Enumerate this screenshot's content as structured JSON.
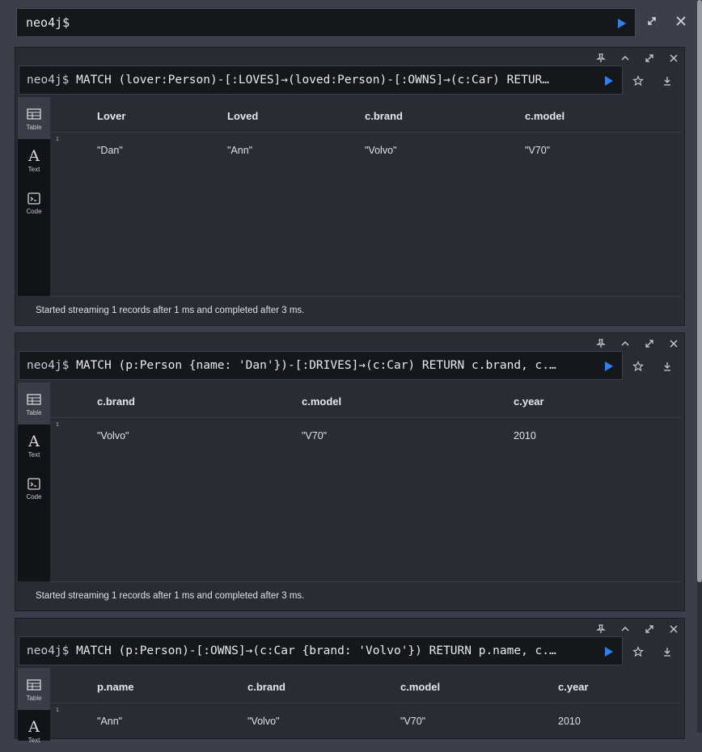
{
  "topbar": {
    "prompt": "neo4j$"
  },
  "frames": [
    {
      "prompt": "neo4j$",
      "query": " MATCH (lover:Person)-[:LOVES]→(loved:Person)-[:OWNS]→(c:Car) RETUR…",
      "tabs": [
        "Table",
        "Text",
        "Code"
      ],
      "columns": [
        "Lover",
        "Loved",
        "c.brand",
        "c.model"
      ],
      "rows": [
        [
          "\"Dan\"",
          "\"Ann\"",
          "\"Volvo\"",
          "\"V70\""
        ]
      ],
      "row_numbers": [
        "1"
      ],
      "status": "Started streaming 1 records after 1 ms and completed after 3 ms."
    },
    {
      "prompt": "neo4j$",
      "query": " MATCH (p:Person {name: 'Dan'})-[:DRIVES]→(c:Car) RETURN c.brand, c.…",
      "tabs": [
        "Table",
        "Text",
        "Code"
      ],
      "columns": [
        "c.brand",
        "c.model",
        "c.year"
      ],
      "rows": [
        [
          "\"Volvo\"",
          "\"V70\"",
          "2010"
        ]
      ],
      "row_numbers": [
        "1"
      ],
      "status": "Started streaming 1 records after 1 ms and completed after 3 ms."
    },
    {
      "prompt": "neo4j$",
      "query": " MATCH (p:Person)-[:OWNS]→(c:Car {brand: 'Volvo'}) RETURN p.name, c.…",
      "tabs": [
        "Table",
        "Text"
      ],
      "columns": [
        "p.name",
        "c.brand",
        "c.model",
        "c.year"
      ],
      "rows": [
        [
          "\"Ann\"",
          "\"Volvo\"",
          "\"V70\"",
          "2010"
        ]
      ],
      "row_numbers": [
        "1"
      ]
    }
  ],
  "icons": {
    "run": "play-icon",
    "expand": "expand-icon",
    "close": "close-icon",
    "pin": "pin-icon",
    "collapse": "chevron-up-icon",
    "favorite": "star-icon",
    "download": "download-icon",
    "table": "table-icon",
    "text": "text-icon",
    "code": "code-icon"
  },
  "colors": {
    "accent": "#2f80ed",
    "background": "#3c3f4a",
    "frame": "#2a2c33",
    "editor": "#16171b"
  }
}
